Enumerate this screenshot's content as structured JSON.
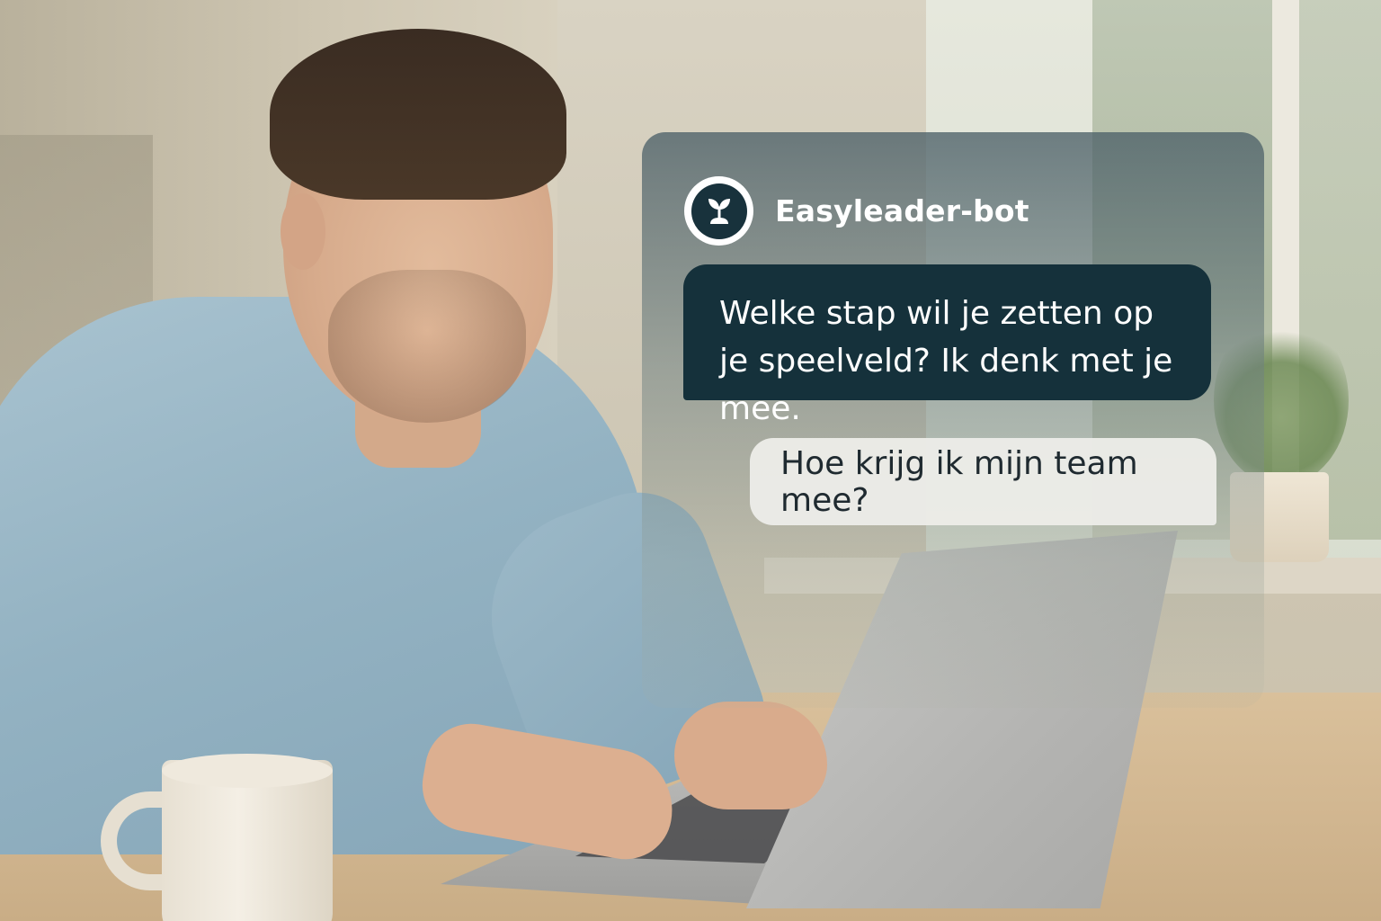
{
  "chat": {
    "bot_name": "Easyleader-bot",
    "bot_avatar_icon": "sprout-icon",
    "messages": [
      {
        "sender": "bot",
        "text": "Welke stap wil je zetten op je speelveld? Ik denk met je mee."
      },
      {
        "sender": "user",
        "text": "Hoe krijg ik mijn team mee?"
      }
    ]
  },
  "colors": {
    "bot_bubble": "#15313b",
    "user_bubble": "#ececE8",
    "panel_tint": "#4c6068"
  }
}
